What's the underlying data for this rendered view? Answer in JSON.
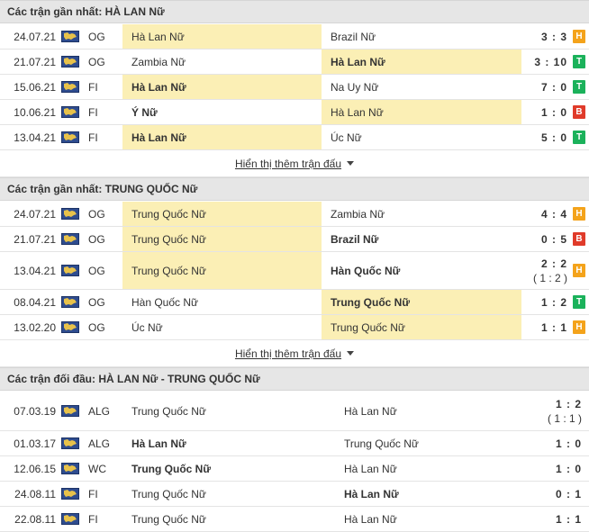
{
  "colors": {
    "highlight": "#fbefb5",
    "draw": "#f4a31b",
    "win": "#1bb25b",
    "loss": "#e03b2a",
    "header_bg": "#e6e6e6"
  },
  "icon": "league-flag-icon",
  "sections": [
    {
      "title": "Các trận gần nhất: HÀ LAN Nữ",
      "more_label": "Hiển thị thêm trận đấu",
      "matches": [
        {
          "date": "24.07.21",
          "comp": "OG",
          "home": "Hà Lan Nữ",
          "away": "Brazil Nữ",
          "score": "3 : 3",
          "sub": "",
          "result": "H",
          "hl": "home",
          "bold": ""
        },
        {
          "date": "21.07.21",
          "comp": "OG",
          "home": "Zambia Nữ",
          "away": "Hà Lan Nữ",
          "score": "3 : 10",
          "sub": "",
          "result": "T",
          "hl": "away",
          "bold": "away"
        },
        {
          "date": "15.06.21",
          "comp": "FI",
          "home": "Hà Lan Nữ",
          "away": "Na Uy Nữ",
          "score": "7 : 0",
          "sub": "",
          "result": "T",
          "hl": "home",
          "bold": "home"
        },
        {
          "date": "10.06.21",
          "comp": "FI",
          "home": "Ý Nữ",
          "away": "Hà Lan Nữ",
          "score": "1 : 0",
          "sub": "",
          "result": "B",
          "hl": "away",
          "bold": "home"
        },
        {
          "date": "13.04.21",
          "comp": "FI",
          "home": "Hà Lan Nữ",
          "away": "Úc Nữ",
          "score": "5 : 0",
          "sub": "",
          "result": "T",
          "hl": "home",
          "bold": "home"
        }
      ]
    },
    {
      "title": "Các trận gần nhất: TRUNG QUỐC Nữ",
      "more_label": "Hiển thị thêm trận đấu",
      "matches": [
        {
          "date": "24.07.21",
          "comp": "OG",
          "home": "Trung Quốc Nữ",
          "away": "Zambia Nữ",
          "score": "4 : 4",
          "sub": "",
          "result": "H",
          "hl": "home",
          "bold": ""
        },
        {
          "date": "21.07.21",
          "comp": "OG",
          "home": "Trung Quốc Nữ",
          "away": "Brazil Nữ",
          "score": "0 : 5",
          "sub": "",
          "result": "B",
          "hl": "home",
          "bold": "away"
        },
        {
          "date": "13.04.21",
          "comp": "OG",
          "home": "Trung Quốc Nữ",
          "away": "Hàn Quốc Nữ",
          "score": "2 : 2",
          "sub": "( 1 : 2 )",
          "result": "H",
          "hl": "home",
          "bold": "away"
        },
        {
          "date": "08.04.21",
          "comp": "OG",
          "home": "Hàn Quốc Nữ",
          "away": "Trung Quốc Nữ",
          "score": "1 : 2",
          "sub": "",
          "result": "T",
          "hl": "away",
          "bold": "away"
        },
        {
          "date": "13.02.20",
          "comp": "OG",
          "home": "Úc Nữ",
          "away": "Trung Quốc Nữ",
          "score": "1 : 1",
          "sub": "",
          "result": "H",
          "hl": "away",
          "bold": ""
        }
      ]
    },
    {
      "title": "Các trận đối đầu: HÀ LAN Nữ - TRUNG QUỐC Nữ",
      "matches": [
        {
          "date": "07.03.19",
          "comp": "ALG",
          "home": "Trung Quốc Nữ",
          "away": "Hà Lan Nữ",
          "score": "1 : 2",
          "sub": "( 1 : 1 )",
          "result": "",
          "hl": "",
          "bold": ""
        },
        {
          "date": "01.03.17",
          "comp": "ALG",
          "home": "Hà Lan Nữ",
          "away": "Trung Quốc Nữ",
          "score": "1 : 0",
          "sub": "",
          "result": "",
          "hl": "",
          "bold": "home"
        },
        {
          "date": "12.06.15",
          "comp": "WC",
          "home": "Trung Quốc Nữ",
          "away": "Hà Lan Nữ",
          "score": "1 : 0",
          "sub": "",
          "result": "",
          "hl": "",
          "bold": "home"
        },
        {
          "date": "24.08.11",
          "comp": "FI",
          "home": "Trung Quốc Nữ",
          "away": "Hà Lan Nữ",
          "score": "0 : 1",
          "sub": "",
          "result": "",
          "hl": "",
          "bold": "away"
        },
        {
          "date": "22.08.11",
          "comp": "FI",
          "home": "Trung Quốc Nữ",
          "away": "Hà Lan Nữ",
          "score": "1 : 1",
          "sub": "",
          "result": "",
          "hl": "",
          "bold": ""
        }
      ]
    }
  ]
}
